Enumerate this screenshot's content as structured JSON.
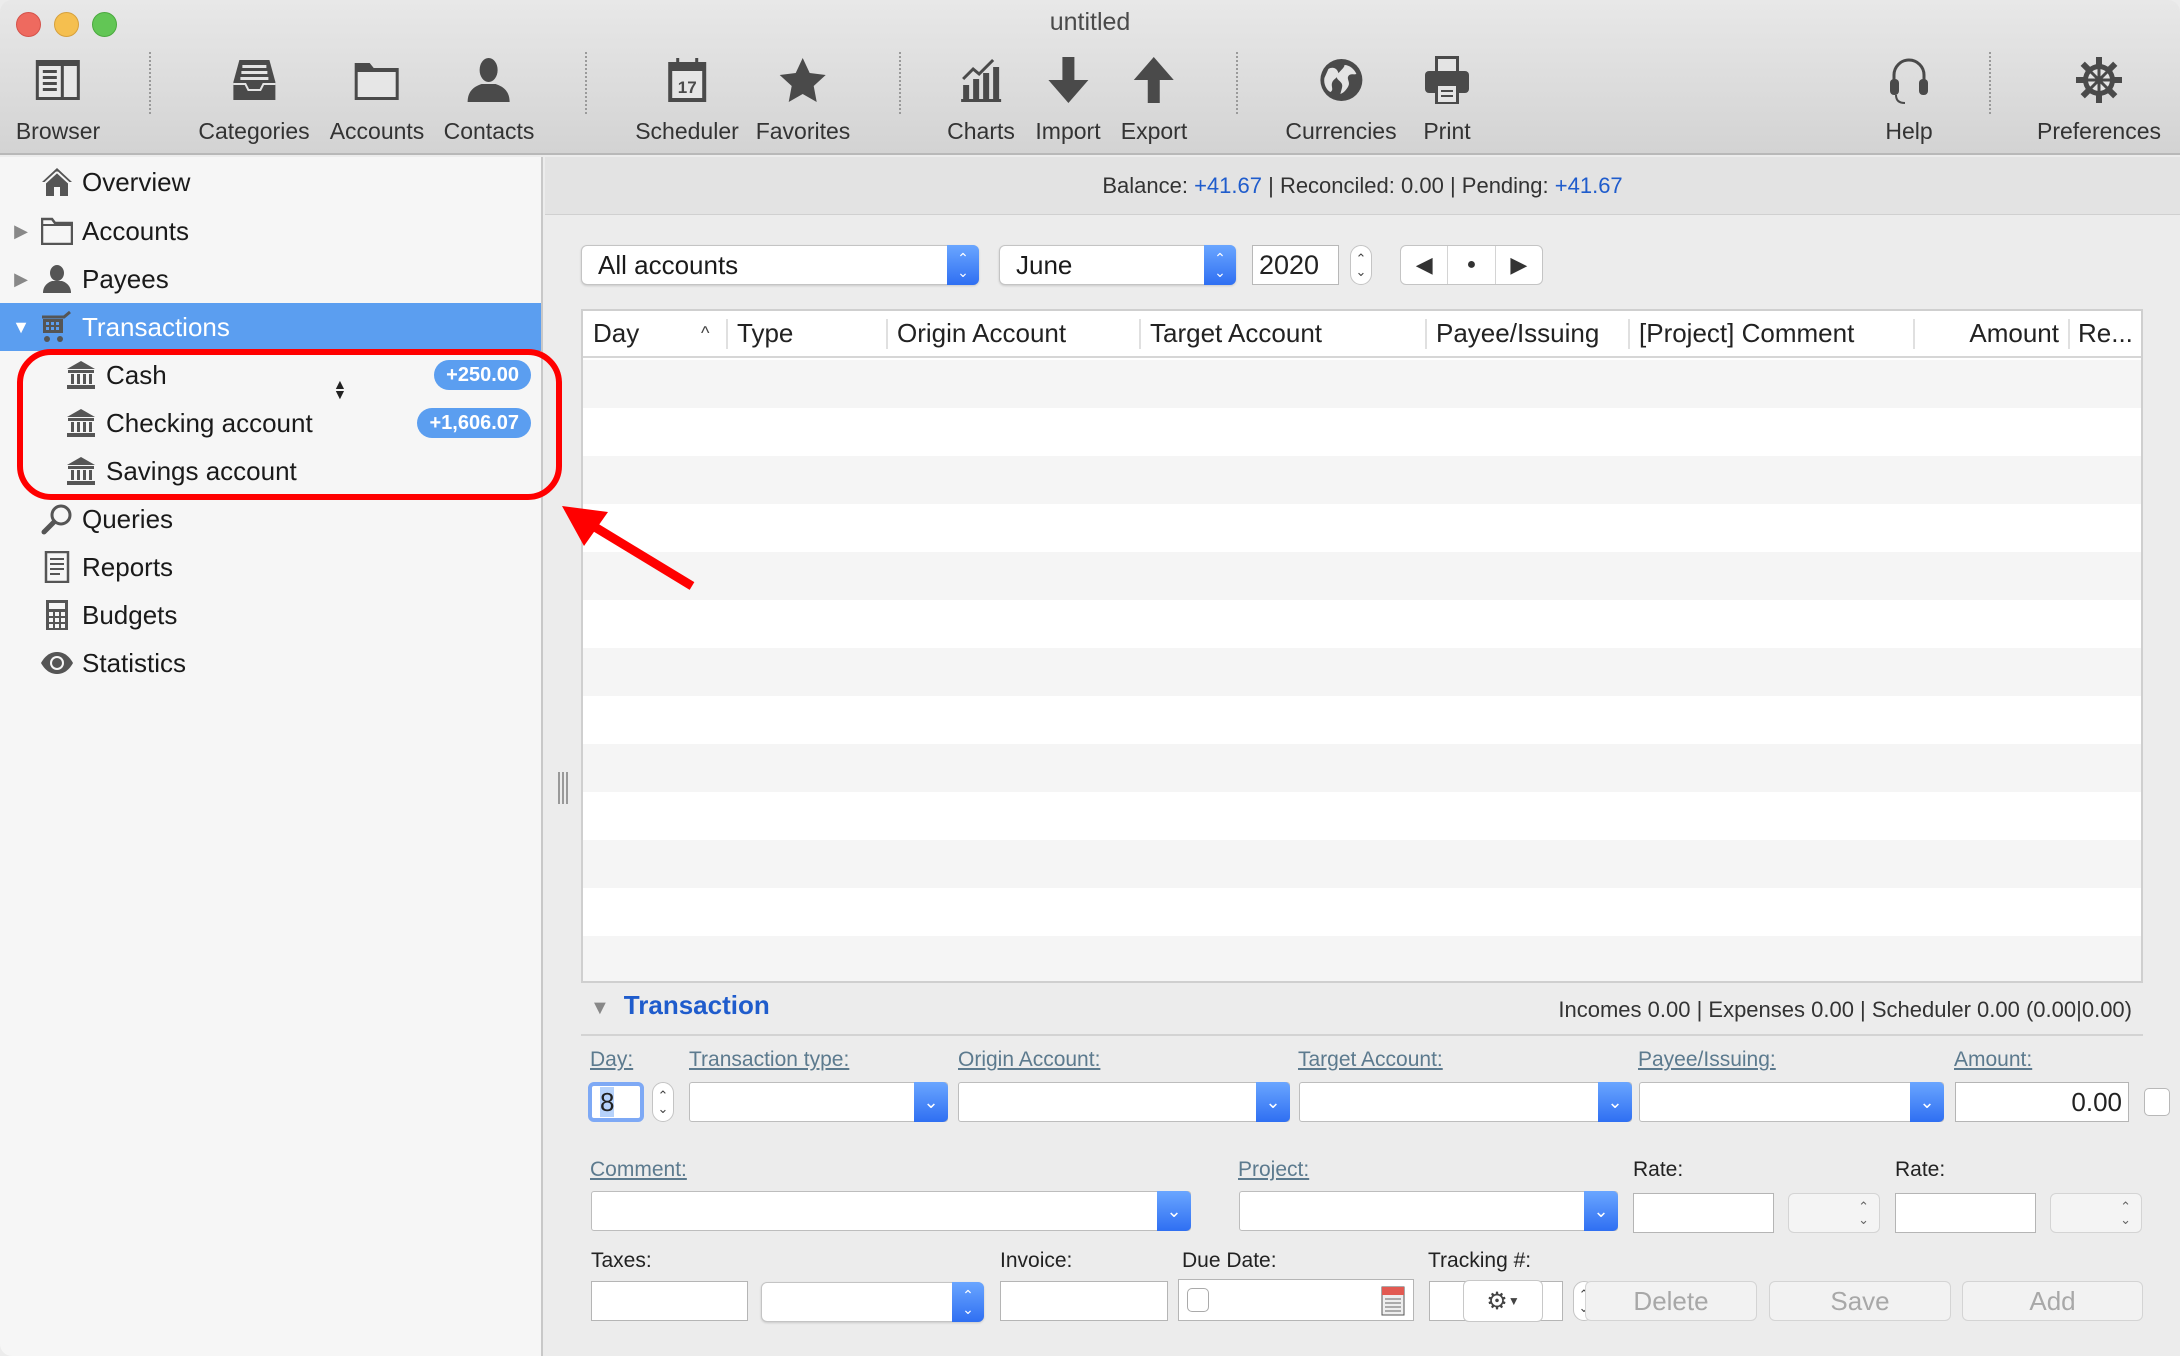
{
  "window": {
    "title": "untitled"
  },
  "colors": {
    "accent": "#5b9ef0",
    "link_blue": "#1f5ccc",
    "annotation_red": "#ff0000"
  },
  "toolbar": {
    "items": [
      {
        "id": "browser",
        "label": "Browser",
        "icon": "browser-icon"
      },
      {
        "id": "categories",
        "label": "Categories",
        "icon": "tray-icon"
      },
      {
        "id": "accounts",
        "label": "Accounts",
        "icon": "folder-icon"
      },
      {
        "id": "contacts",
        "label": "Contacts",
        "icon": "person-icon"
      },
      {
        "id": "scheduler",
        "label": "Scheduler",
        "icon": "calendar-icon",
        "day": "17"
      },
      {
        "id": "favorites",
        "label": "Favorites",
        "icon": "star-icon"
      },
      {
        "id": "charts",
        "label": "Charts",
        "icon": "chart-icon"
      },
      {
        "id": "import",
        "label": "Import",
        "icon": "arrow-down-icon"
      },
      {
        "id": "export",
        "label": "Export",
        "icon": "arrow-up-icon"
      },
      {
        "id": "currencies",
        "label": "Currencies",
        "icon": "globe-icon"
      },
      {
        "id": "print",
        "label": "Print",
        "icon": "printer-icon"
      },
      {
        "id": "help",
        "label": "Help",
        "icon": "headset-icon"
      },
      {
        "id": "preferences",
        "label": "Preferences",
        "icon": "gear-icon"
      }
    ]
  },
  "sidebar": {
    "items": [
      {
        "label": "Overview",
        "icon": "house-icon"
      },
      {
        "label": "Accounts",
        "icon": "folder-icon",
        "disclosure": "collapsed"
      },
      {
        "label": "Payees",
        "icon": "person-icon",
        "disclosure": "collapsed"
      },
      {
        "label": "Transactions",
        "icon": "cart-icon",
        "disclosure": "expanded",
        "selected": true
      },
      {
        "label": "Cash",
        "icon": "bank-icon",
        "badge": "+250.00",
        "child": true
      },
      {
        "label": "Checking account",
        "icon": "bank-icon",
        "badge": "+1,606.07",
        "child": true
      },
      {
        "label": "Savings account",
        "icon": "bank-icon",
        "child": true
      },
      {
        "label": "Queries",
        "icon": "magnifier-icon"
      },
      {
        "label": "Reports",
        "icon": "document-icon"
      },
      {
        "label": "Budgets",
        "icon": "calculator-icon"
      },
      {
        "label": "Statistics",
        "icon": "eye-icon"
      }
    ]
  },
  "balance": {
    "balance_label": "Balance:",
    "balance_value": "+41.67",
    "sep1": " | ",
    "reconciled": "Reconciled: 0.00",
    "sep2": " | ",
    "pending_label": "Pending:",
    "pending_value": "+41.67"
  },
  "filters": {
    "account": "All accounts",
    "month": "June",
    "year": "2020",
    "nav": {
      "prev": "◀",
      "today": "●",
      "next": "▶"
    }
  },
  "table": {
    "columns": [
      "Day",
      "Type",
      "Origin Account",
      "Target Account",
      "Payee/Issuing",
      "[Project] Comment",
      "Amount",
      "Re..."
    ],
    "sort_indicator": "^",
    "rows": []
  },
  "transaction": {
    "title": "Transaction",
    "summary": "Incomes 0.00 | Expenses 0.00 | Scheduler 0.00 (0.00|0.00)",
    "labels": {
      "day": "Day:",
      "type": "Transaction type:",
      "origin": "Origin Account:",
      "target": "Target Account:",
      "payee": "Payee/Issuing:",
      "amount": "Amount:",
      "comment": "Comment:",
      "project": "Project:",
      "rate1": "Rate:",
      "rate2": "Rate:",
      "taxes": "Taxes:",
      "invoice": "Invoice:",
      "due": "Due Date:",
      "tracking": "Tracking #:"
    },
    "values": {
      "day": "8",
      "amount": "0.00"
    },
    "buttons": {
      "delete": "Delete",
      "save": "Save",
      "add": "Add"
    }
  }
}
